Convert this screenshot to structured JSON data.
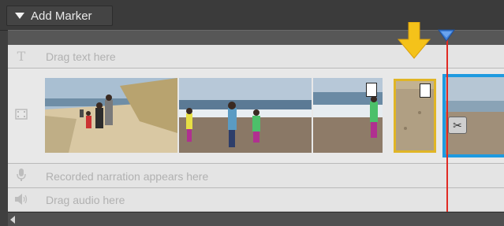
{
  "toolbar": {
    "add_marker_label": "Add Marker"
  },
  "tracks": {
    "text_placeholder": "Drag text here",
    "narration_placeholder": "Recorded narration appears here",
    "audio_placeholder": "Drag audio here"
  },
  "icons": {
    "text_track": "text-T-icon",
    "video_track": "film-icon",
    "narration_track": "microphone-icon",
    "audio_track": "speaker-icon",
    "split": "scissors-icon"
  },
  "colors": {
    "selected_clip_border": "#1e9ae0",
    "highlight_clip_border": "#e0b526",
    "arrow": "#f4c21a",
    "playhead": "#e02a23",
    "playhead_cap": "#3f7fd6"
  }
}
